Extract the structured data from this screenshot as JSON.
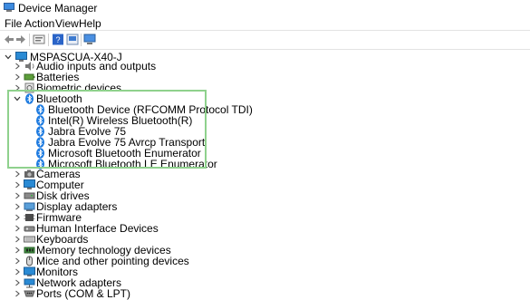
{
  "window": {
    "title": "Device Manager"
  },
  "menu": {
    "items": [
      "File",
      "Action",
      "View",
      "Help"
    ]
  },
  "toolbar": {
    "buttons": [
      "back-icon",
      "forward-icon",
      "properties-icon",
      "help-icon",
      "update-driver-icon",
      "scan-hardware-icon"
    ]
  },
  "tree": {
    "root": "MSPASCUA-X40-J",
    "before": [
      {
        "label": "Audio inputs and outputs",
        "icon": "speaker-icon"
      },
      {
        "label": "Batteries",
        "icon": "battery-icon"
      },
      {
        "label": "Biometric devices",
        "icon": "biometric-icon"
      }
    ],
    "bluetooth": {
      "label": "Bluetooth",
      "children": [
        "Bluetooth Device (RFCOMM Protocol TDI)",
        "Intel(R) Wireless Bluetooth(R)",
        "Jabra Evolve 75",
        "Jabra Evolve 75 Avrcp Transport",
        "Microsoft Bluetooth Enumerator",
        "Microsoft Bluetooth LE Enumerator"
      ]
    },
    "after": [
      {
        "label": "Cameras",
        "icon": "camera-icon"
      },
      {
        "label": "Computer",
        "icon": "computer-icon"
      },
      {
        "label": "Disk drives",
        "icon": "disk-icon"
      },
      {
        "label": "Display adapters",
        "icon": "display-icon"
      },
      {
        "label": "Firmware",
        "icon": "firmware-icon"
      },
      {
        "label": "Human Interface Devices",
        "icon": "hid-icon"
      },
      {
        "label": "Keyboards",
        "icon": "keyboard-icon"
      },
      {
        "label": "Memory technology devices",
        "icon": "memory-icon"
      },
      {
        "label": "Mice and other pointing devices",
        "icon": "mouse-icon"
      },
      {
        "label": "Monitors",
        "icon": "monitor-icon"
      },
      {
        "label": "Network adapters",
        "icon": "network-icon"
      },
      {
        "label": "Ports (COM & LPT)",
        "icon": "port-icon"
      }
    ]
  },
  "colors": {
    "bluetooth": "#1e7be0",
    "highlight": "#8fd18d",
    "computer": "#2a8ad4"
  }
}
